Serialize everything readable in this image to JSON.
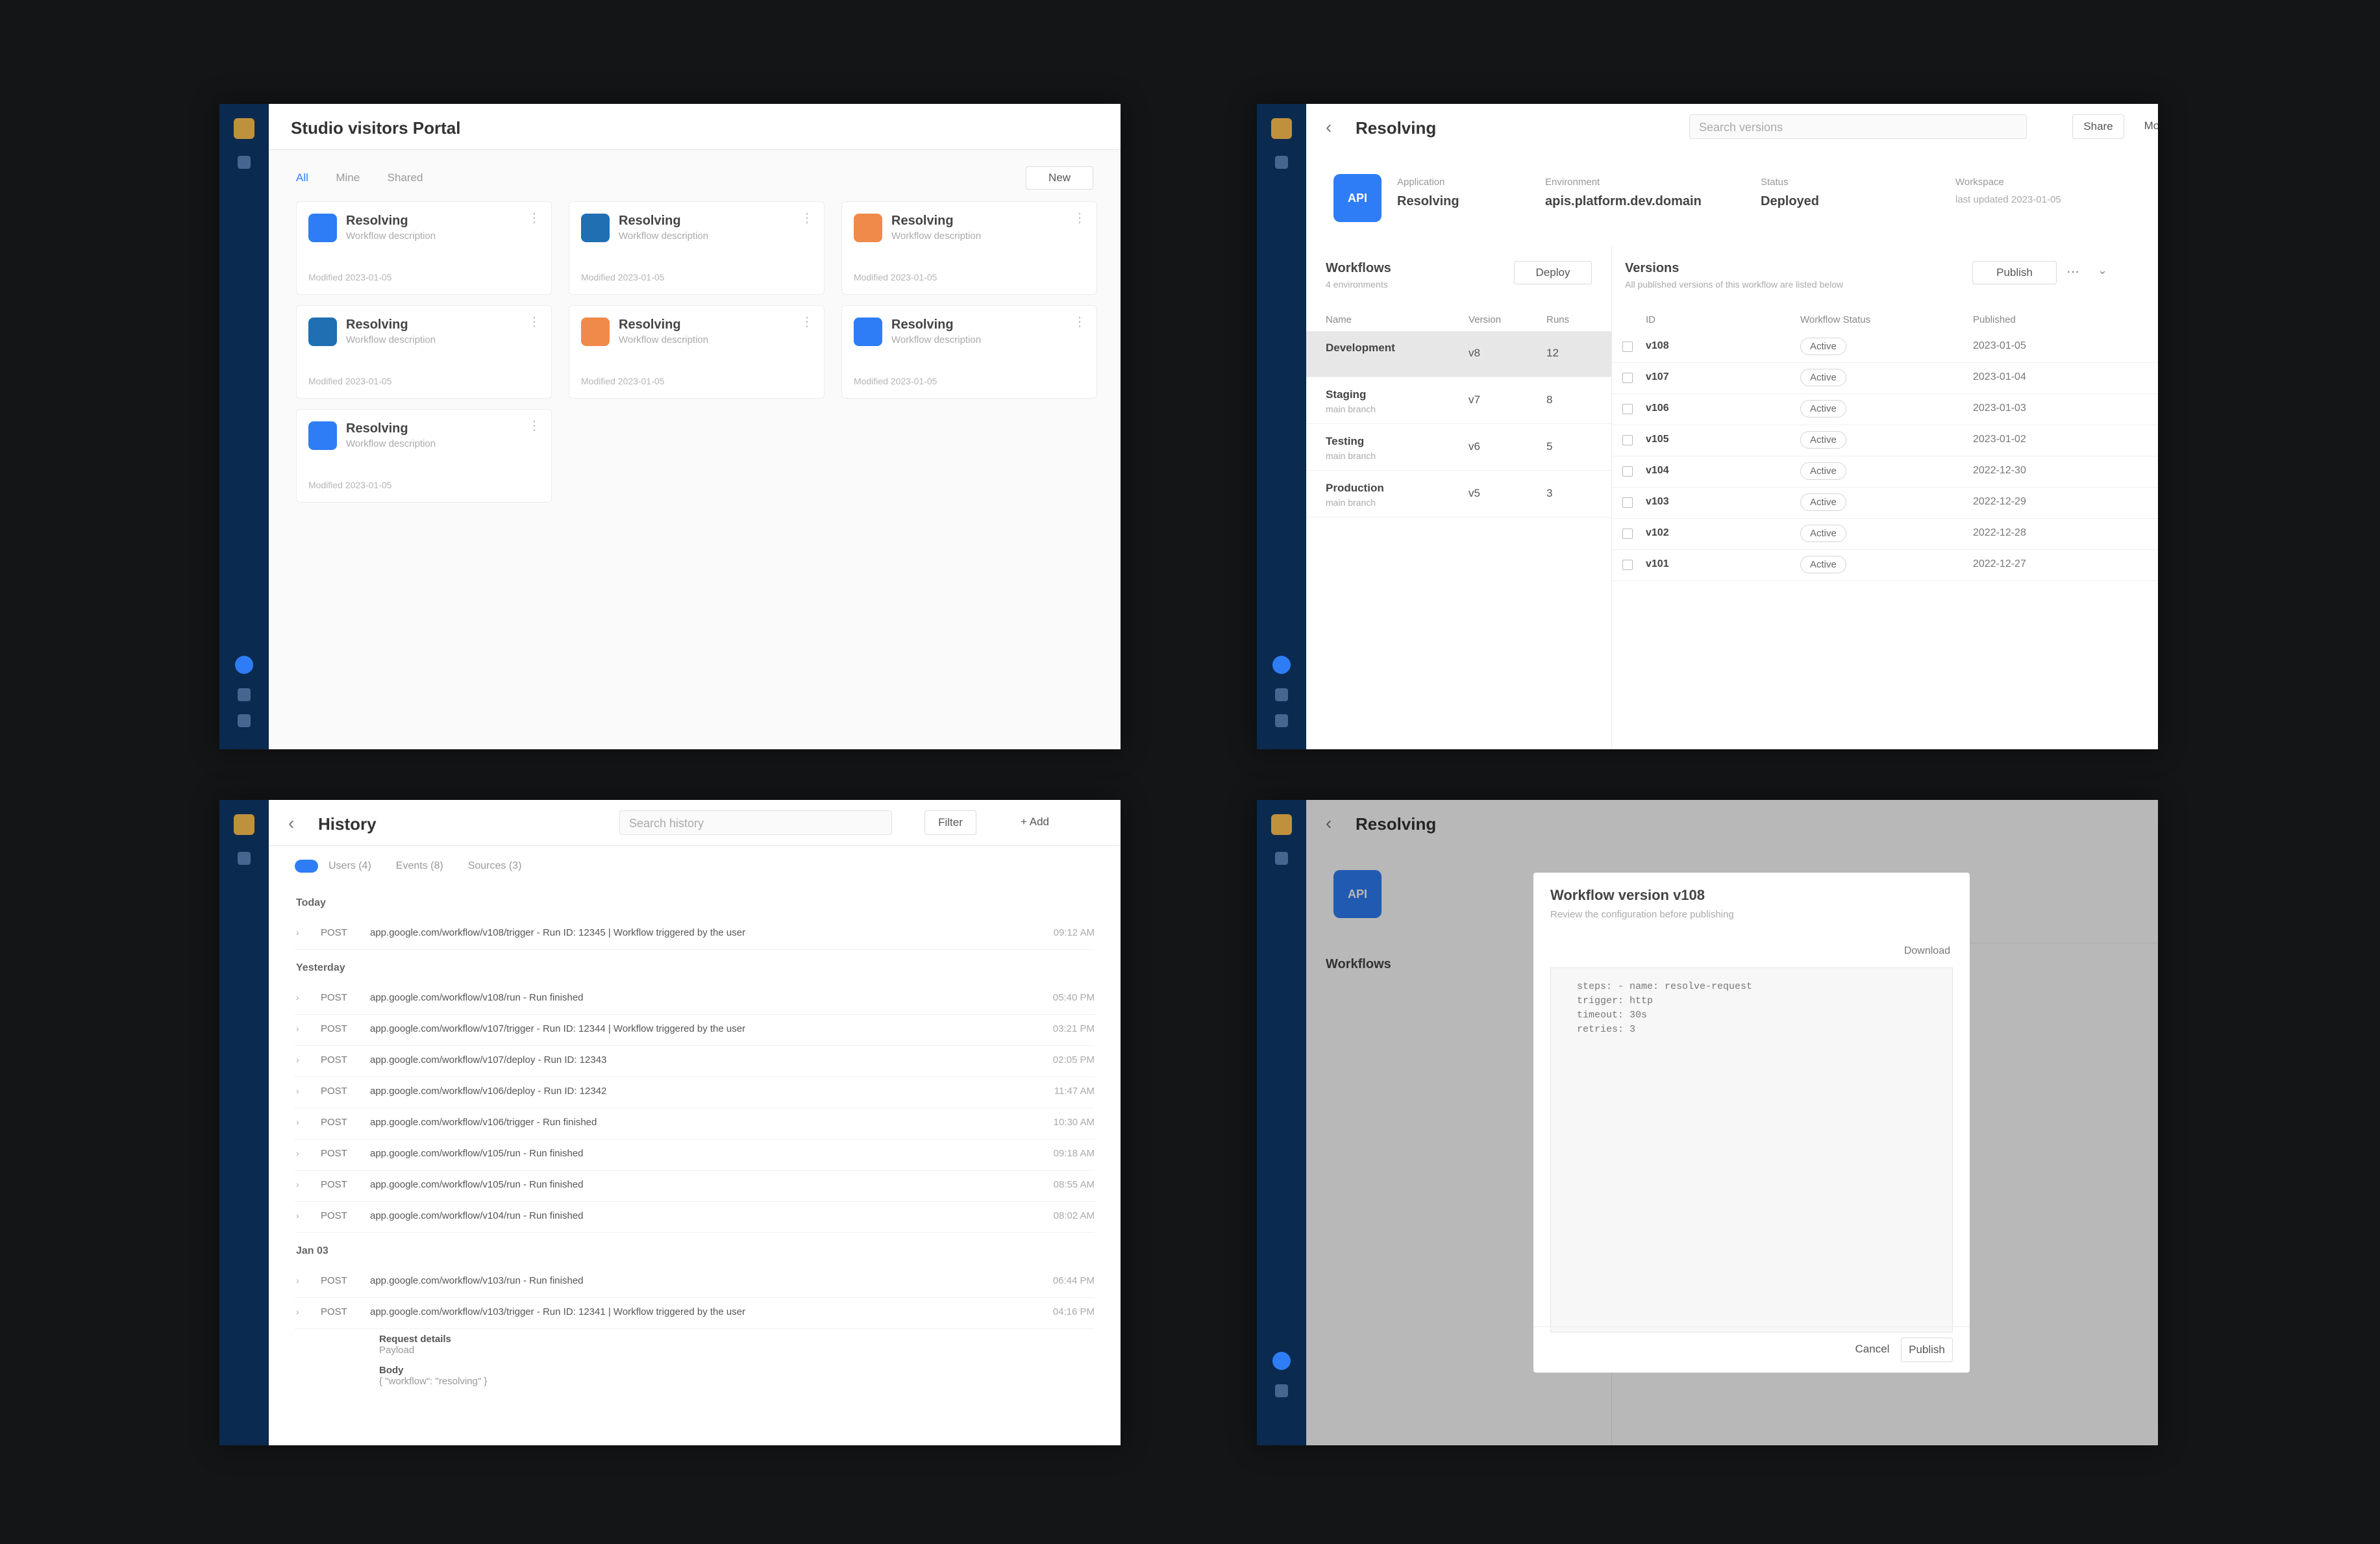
{
  "panel1": {
    "title": "Studio visitors Portal",
    "tabs": [
      "All",
      "Mine",
      "Shared"
    ],
    "new_button": "New",
    "cards": [
      {
        "title": "Resolving",
        "subtitle": "Workflow description",
        "footer": "Modified 2023-01-05",
        "color": "#2f7df6"
      },
      {
        "title": "Resolving",
        "subtitle": "Workflow description",
        "footer": "Modified 2023-01-05",
        "color": "#1f6fb2"
      },
      {
        "title": "Resolving",
        "subtitle": "Workflow description",
        "footer": "Modified 2023-01-05",
        "color": "#f08a4b"
      },
      {
        "title": "Resolving",
        "subtitle": "Workflow description",
        "footer": "Modified 2023-01-05",
        "color": "#1f6fb2"
      },
      {
        "title": "Resolving",
        "subtitle": "Workflow description",
        "footer": "Modified 2023-01-05",
        "color": "#f08a4b"
      },
      {
        "title": "Resolving",
        "subtitle": "Workflow description",
        "footer": "Modified 2023-01-05",
        "color": "#2f7df6"
      },
      {
        "title": "Resolving",
        "subtitle": "Workflow description",
        "footer": "Modified 2023-01-05",
        "color": "#2f7df6"
      }
    ]
  },
  "panel2": {
    "title": "Resolving",
    "search_placeholder": "Search versions",
    "btn_a": "Share",
    "btn_b": "More",
    "icon_text": "API",
    "meta": [
      {
        "label": "Application",
        "value": "Resolving"
      },
      {
        "label": "Environment",
        "value": "apis.platform.dev.domain"
      },
      {
        "label": "Status",
        "value": "Deployed"
      },
      {
        "label": "Workspace",
        "value": "last updated 2023-01-05"
      }
    ],
    "left_title": "Workflows",
    "left_subtitle": "4 environments",
    "left_button": "Deploy",
    "left_headers": [
      "Name",
      "Version",
      "Runs"
    ],
    "left_rows": [
      {
        "name": "Development",
        "sub": "",
        "v": "v8",
        "r": "12"
      },
      {
        "name": "Staging",
        "sub": "main branch",
        "v": "v7",
        "r": "8"
      },
      {
        "name": "Testing",
        "sub": "main branch",
        "v": "v6",
        "r": "5"
      },
      {
        "name": "Production",
        "sub": "main branch",
        "v": "v5",
        "r": "3"
      }
    ],
    "right_title": "Versions",
    "right_subtitle": "All published versions of this workflow are listed below",
    "right_button": "Publish",
    "right_headers": [
      "ID",
      "Workflow Status",
      "Published"
    ],
    "versions": [
      {
        "id": "v108",
        "status": "Active",
        "date": "2023-01-05"
      },
      {
        "id": "v107",
        "status": "Active",
        "date": "2023-01-04"
      },
      {
        "id": "v106",
        "status": "Active",
        "date": "2023-01-03"
      },
      {
        "id": "v105",
        "status": "Active",
        "date": "2023-01-02"
      },
      {
        "id": "v104",
        "status": "Active",
        "date": "2022-12-30"
      },
      {
        "id": "v103",
        "status": "Active",
        "date": "2022-12-29"
      },
      {
        "id": "v102",
        "status": "Active",
        "date": "2022-12-28"
      },
      {
        "id": "v101",
        "status": "Active",
        "date": "2022-12-27"
      }
    ]
  },
  "panel3": {
    "title": "History",
    "search_placeholder": "Search history",
    "btn_a": "Filter",
    "btn_b": "+ Add",
    "filters": [
      "Users (4)",
      "Events (8)",
      "Sources (3)"
    ],
    "groups": [
      {
        "date": "Today",
        "rows": [
          {
            "code": "POST",
            "text": "app.google.com/workflow/v108/trigger - Run ID: 12345 | Workflow triggered by the user",
            "time": "09:12 AM"
          }
        ]
      },
      {
        "date": "Yesterday",
        "rows": [
          {
            "code": "POST",
            "text": "app.google.com/workflow/v108/run - Run finished",
            "time": "05:40 PM"
          },
          {
            "code": "POST",
            "text": "app.google.com/workflow/v107/trigger - Run ID: 12344 | Workflow triggered by the user",
            "time": "03:21 PM"
          },
          {
            "code": "POST",
            "text": "app.google.com/workflow/v107/deploy - Run ID: 12343",
            "time": "02:05 PM"
          },
          {
            "code": "POST",
            "text": "app.google.com/workflow/v106/deploy - Run ID: 12342",
            "time": "11:47 AM"
          },
          {
            "code": "POST",
            "text": "app.google.com/workflow/v106/trigger - Run finished",
            "time": "10:30 AM"
          },
          {
            "code": "POST",
            "text": "app.google.com/workflow/v105/run - Run finished",
            "time": "09:18 AM"
          },
          {
            "code": "POST",
            "text": "app.google.com/workflow/v105/run - Run finished",
            "time": "08:55 AM"
          },
          {
            "code": "POST",
            "text": "app.google.com/workflow/v104/run - Run finished",
            "time": "08:02 AM"
          }
        ]
      },
      {
        "date": "Jan 03",
        "rows": [
          {
            "code": "POST",
            "text": "app.google.com/workflow/v103/run - Run finished",
            "time": "06:44 PM"
          },
          {
            "code": "POST",
            "text": "app.google.com/workflow/v103/trigger - Run ID: 12341 | Workflow triggered by the user",
            "time": "04:16 PM"
          }
        ]
      }
    ],
    "detail": [
      {
        "label": "Request details",
        "value": "Payload"
      },
      {
        "label": "Body",
        "value": "{ \"workflow\": \"resolving\" }"
      }
    ]
  },
  "panel4": {
    "title": "Resolving",
    "modal_title": "Workflow version v108",
    "modal_subtitle": "Review the configuration before publishing",
    "modal_link": "Download",
    "code_lines": [
      "steps: - name: resolve-request",
      "  trigger: http",
      "  timeout: 30s",
      "  retries: 3"
    ],
    "cancel": "Cancel",
    "publish": "Publish"
  }
}
